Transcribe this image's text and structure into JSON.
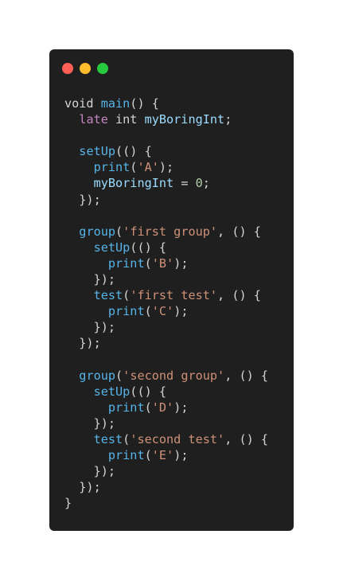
{
  "window": {
    "controls": [
      {
        "name": "close",
        "color": "#ff5f56"
      },
      {
        "name": "minimize",
        "color": "#ffbd2e"
      },
      {
        "name": "maximize",
        "color": "#27c93f"
      }
    ]
  },
  "code": {
    "lines": [
      [
        {
          "t": "void ",
          "c": "plain"
        },
        {
          "t": "main",
          "c": "fn"
        },
        {
          "t": "() {",
          "c": "plain"
        }
      ],
      [
        {
          "t": "  ",
          "c": "plain"
        },
        {
          "t": "late",
          "c": "kw"
        },
        {
          "t": " int ",
          "c": "plain"
        },
        {
          "t": "myBoringInt",
          "c": "ident"
        },
        {
          "t": ";",
          "c": "plain"
        }
      ],
      [],
      [
        {
          "t": "  ",
          "c": "plain"
        },
        {
          "t": "setUp",
          "c": "fn"
        },
        {
          "t": "(() {",
          "c": "plain"
        }
      ],
      [
        {
          "t": "    ",
          "c": "plain"
        },
        {
          "t": "print",
          "c": "fn"
        },
        {
          "t": "(",
          "c": "plain"
        },
        {
          "t": "'A'",
          "c": "str"
        },
        {
          "t": ");",
          "c": "plain"
        }
      ],
      [
        {
          "t": "    ",
          "c": "plain"
        },
        {
          "t": "myBoringInt",
          "c": "ident"
        },
        {
          "t": " = ",
          "c": "plain"
        },
        {
          "t": "0",
          "c": "num"
        },
        {
          "t": ";",
          "c": "plain"
        }
      ],
      [
        {
          "t": "  });",
          "c": "plain"
        }
      ],
      [],
      [
        {
          "t": "  ",
          "c": "plain"
        },
        {
          "t": "group",
          "c": "fn"
        },
        {
          "t": "(",
          "c": "plain"
        },
        {
          "t": "'first group'",
          "c": "str"
        },
        {
          "t": ", () {",
          "c": "plain"
        }
      ],
      [
        {
          "t": "    ",
          "c": "plain"
        },
        {
          "t": "setUp",
          "c": "fn"
        },
        {
          "t": "(() {",
          "c": "plain"
        }
      ],
      [
        {
          "t": "      ",
          "c": "plain"
        },
        {
          "t": "print",
          "c": "fn"
        },
        {
          "t": "(",
          "c": "plain"
        },
        {
          "t": "'B'",
          "c": "str"
        },
        {
          "t": ");",
          "c": "plain"
        }
      ],
      [
        {
          "t": "    });",
          "c": "plain"
        }
      ],
      [
        {
          "t": "    ",
          "c": "plain"
        },
        {
          "t": "test",
          "c": "fn"
        },
        {
          "t": "(",
          "c": "plain"
        },
        {
          "t": "'first test'",
          "c": "str"
        },
        {
          "t": ", () {",
          "c": "plain"
        }
      ],
      [
        {
          "t": "      ",
          "c": "plain"
        },
        {
          "t": "print",
          "c": "fn"
        },
        {
          "t": "(",
          "c": "plain"
        },
        {
          "t": "'C'",
          "c": "str"
        },
        {
          "t": ");",
          "c": "plain"
        }
      ],
      [
        {
          "t": "    });",
          "c": "plain"
        }
      ],
      [
        {
          "t": "  });",
          "c": "plain"
        }
      ],
      [],
      [
        {
          "t": "  ",
          "c": "plain"
        },
        {
          "t": "group",
          "c": "fn"
        },
        {
          "t": "(",
          "c": "plain"
        },
        {
          "t": "'second group'",
          "c": "str"
        },
        {
          "t": ", () {",
          "c": "plain"
        }
      ],
      [
        {
          "t": "    ",
          "c": "plain"
        },
        {
          "t": "setUp",
          "c": "fn"
        },
        {
          "t": "(() {",
          "c": "plain"
        }
      ],
      [
        {
          "t": "      ",
          "c": "plain"
        },
        {
          "t": "print",
          "c": "fn"
        },
        {
          "t": "(",
          "c": "plain"
        },
        {
          "t": "'D'",
          "c": "str"
        },
        {
          "t": ");",
          "c": "plain"
        }
      ],
      [
        {
          "t": "    });",
          "c": "plain"
        }
      ],
      [
        {
          "t": "    ",
          "c": "plain"
        },
        {
          "t": "test",
          "c": "fn"
        },
        {
          "t": "(",
          "c": "plain"
        },
        {
          "t": "'second test'",
          "c": "str"
        },
        {
          "t": ", () {",
          "c": "plain"
        }
      ],
      [
        {
          "t": "      ",
          "c": "plain"
        },
        {
          "t": "print",
          "c": "fn"
        },
        {
          "t": "(",
          "c": "plain"
        },
        {
          "t": "'E'",
          "c": "str"
        },
        {
          "t": ");",
          "c": "plain"
        }
      ],
      [
        {
          "t": "    });",
          "c": "plain"
        }
      ],
      [
        {
          "t": "  });",
          "c": "plain"
        }
      ],
      [
        {
          "t": "}",
          "c": "plain"
        }
      ]
    ]
  }
}
